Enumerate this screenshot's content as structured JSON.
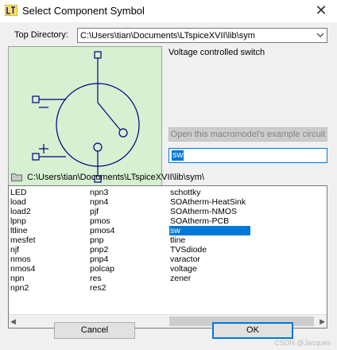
{
  "window": {
    "title": "Select Component Symbol",
    "close_glyph": "✕",
    "app_icon": "ltspice-icon"
  },
  "top_directory": {
    "label": "Top Directory:",
    "value": "C:\\Users\\tian\\Documents\\LTspiceXVII\\lib\\sym"
  },
  "preview": {
    "description": "Voltage controlled switch",
    "symbol": "voltage-controlled-switch",
    "background": "#d6f0d1",
    "stroke": "#000080"
  },
  "example_button": {
    "label": "Open this macromodel's example circuit"
  },
  "search": {
    "value": "sw"
  },
  "current_path": "C:\\Users\\tian\\Documents\\LTspiceXVII\\lib\\sym\\",
  "list": {
    "columns": [
      [
        "LED",
        "load",
        "load2",
        "lpnp",
        "ltline",
        "mesfet",
        "njf",
        "nmos",
        "nmos4",
        "npn",
        "npn2"
      ],
      [
        "npn3",
        "npn4",
        "pjf",
        "pmos",
        "pmos4",
        "pnp",
        "pnp2",
        "pnp4",
        "polcap",
        "res",
        "res2"
      ],
      [
        "schottky",
        "SOAtherm-HeatSink",
        "SOAtherm-NMOS",
        "SOAtherm-PCB",
        "sw",
        "tline",
        "TVSdiode",
        "varactor",
        "voltage",
        "zener"
      ]
    ],
    "selected": "sw"
  },
  "buttons": {
    "cancel": "Cancel",
    "ok": "OK"
  },
  "watermark": "CSDN @Jacques",
  "colors": {
    "selection": "#0078d7",
    "dialog_bg": "#f0f0f0"
  }
}
